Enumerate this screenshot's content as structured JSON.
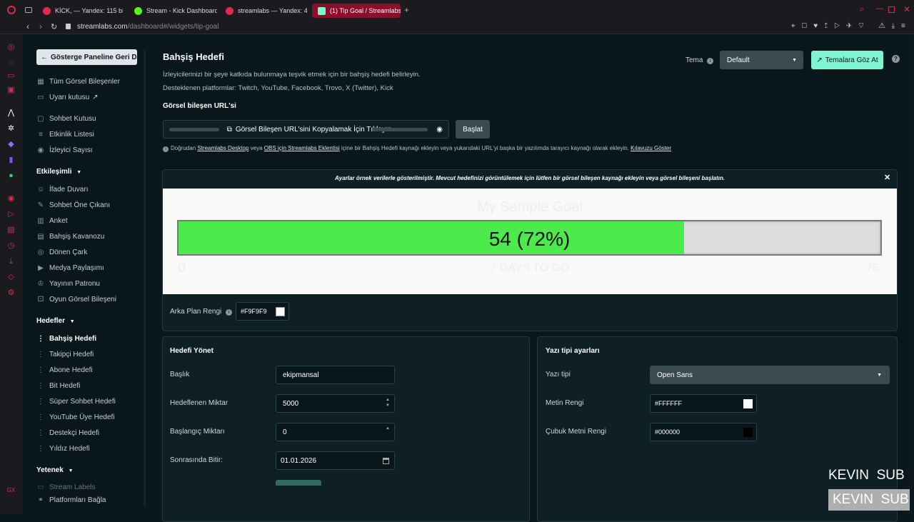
{
  "browser": {
    "tabs": [
      {
        "title": "KİCK, — Yandex: 115 bin s",
        "color": "#e0294b"
      },
      {
        "title": "Stream - Kick Dashboard",
        "color": "#53fc18"
      },
      {
        "title": "streamlabs — Yandex: 4 s",
        "color": "#e0294b"
      },
      {
        "title": "(1) Tip Goal / Streamlabs",
        "color": "#80f5d2"
      }
    ],
    "url_host": "streamlabs.com",
    "url_path": "/dashboard#/widgets/tip-goal"
  },
  "sidebar": {
    "back_button": "Gösterge Paneline Geri Dön",
    "top_items": [
      {
        "label": "Tüm Görsel Bileşenler",
        "icon": "grid-icon"
      },
      {
        "label": "Uyarı kutusu",
        "icon": "external-link-icon"
      },
      {
        "label": "Sohbet Kutusu",
        "icon": "chat-icon"
      },
      {
        "label": "Etkinlik Listesi",
        "icon": "list-icon"
      },
      {
        "label": "İzleyici Sayısı",
        "icon": "eye-icon"
      }
    ],
    "group1_title": "Etkileşimli",
    "group1_items": [
      {
        "label": "İfade Duvarı",
        "icon": "emote-icon"
      },
      {
        "label": "Sohbet Öne Çıkanı",
        "icon": "pin-icon"
      },
      {
        "label": "Anket",
        "icon": "poll-icon"
      },
      {
        "label": "Bahşiş Kavanozu",
        "icon": "jar-icon"
      },
      {
        "label": "Dönen Çark",
        "icon": "wheel-icon"
      },
      {
        "label": "Medya Paylaşımı",
        "icon": "media-icon"
      },
      {
        "label": "Yayının Patronu",
        "icon": "crown-icon"
      },
      {
        "label": "Oyun Görsel Bileşeni",
        "icon": "game-icon"
      }
    ],
    "group2_title": "Hedefler",
    "group2_items": [
      {
        "label": "Bahşiş Hedefi",
        "icon": "goal-icon"
      },
      {
        "label": "Takipçi Hedefi",
        "icon": "goal-icon"
      },
      {
        "label": "Abone Hedefi",
        "icon": "goal-icon"
      },
      {
        "label": "Bit Hedefi",
        "icon": "goal-icon"
      },
      {
        "label": "Süper Sohbet Hedefi",
        "icon": "goal-icon"
      },
      {
        "label": "YouTube Üye Hedefi",
        "icon": "goal-icon"
      },
      {
        "label": "Destekçi Hedefi",
        "icon": "goal-icon"
      },
      {
        "label": "Yıldız Hedefi",
        "icon": "goal-icon"
      }
    ],
    "group3_title": "Yetenek",
    "group3_items": [
      {
        "label": "Stream Labels",
        "icon": "label-icon"
      },
      {
        "label": "Platformları Bağla",
        "icon": "link-icon"
      }
    ]
  },
  "header": {
    "title": "Bahşiş Hedefi",
    "desc1": "İzleyicilerinizi bir şeye katkıda bulunmaya teşvik etmek için bir bahşiş hedefi belirleyin.",
    "desc2": "Desteklenen platformlar: Twitch, YouTube, Facebook, Trovo, X (Twitter), Kick",
    "theme_label": "Tema",
    "theme_value": "Default",
    "browse_themes": "Temalara Göz At"
  },
  "url_section": {
    "label": "Görsel bileşen URL'si",
    "copy_text": "Görsel Bileşen URL'sini Kopyalamak İçin Tıklayın",
    "start_button": "Başlat",
    "info_pre": "Doğrudan",
    "link1": "Streamlabs Desktop",
    "info_mid1": "veya",
    "link2": "OBS için Streamlabs Eklentisi",
    "info_mid2": "içine bir Bahşiş Hedefi kaynağı ekleyin veya yukarıdaki URL'yi başka bir yazılımda tarayıcı kaynağı olarak ekleyin.",
    "link3": "Kılavuzu Göster"
  },
  "preview": {
    "notice": "Ayarlar örnek verilerle gösterilmiştir. Mevcut hedefinizi görüntülemek için lütfen bir görsel bileşen kaynağı ekleyin veya görsel bileşeni başlatın.",
    "goal_title": "My Sample Goal",
    "bar_text": "54 (72%)",
    "progress": 0.72,
    "min": "0",
    "max": "75",
    "days_left": "7 DAYS TO GO",
    "bar_color": "#4cea4c",
    "bg_label": "Arka Plan Rengi",
    "bg_value": "#F9F9F9"
  },
  "manage": {
    "title": "Hedefi Yönet",
    "title_label": "Başlık",
    "title_value": "ekipmansal",
    "target_label": "Hedeflenen Miktar",
    "target_value": "5000",
    "start_label": "Başlangıç Miktarı",
    "start_value": "0",
    "end_label": "Sonrasında Bitir:",
    "end_value": "01.01.2026"
  },
  "font": {
    "title": "Yazı tipi ayarları",
    "font_label": "Yazı tipi",
    "font_value": "Open Sans",
    "text_color_label": "Metin Rengi",
    "text_color_value": "#FFFFFF",
    "bar_text_label": "Çubuk Metni Rengi",
    "bar_text_value": "#000000"
  },
  "overlay": {
    "line1": "KEVIN  SUB",
    "line2": "KEVIN  SUB"
  }
}
